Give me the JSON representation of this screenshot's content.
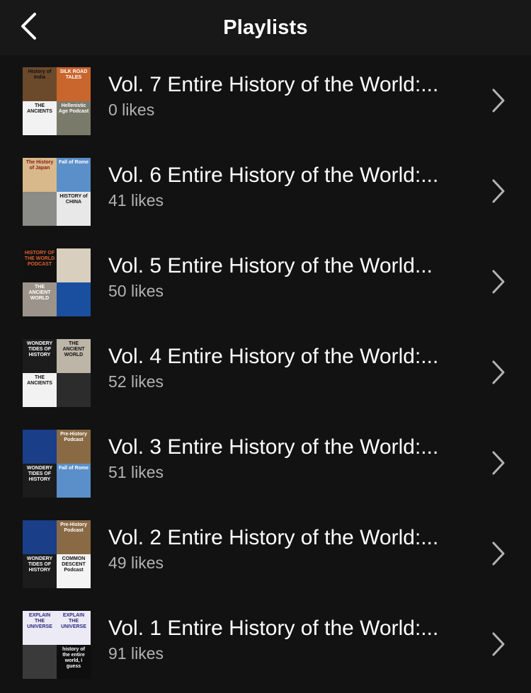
{
  "header": {
    "title": "Playlists"
  },
  "colors": {
    "background": "#121212",
    "header_bg": "#181818",
    "secondary_text": "#b3b3b3"
  },
  "playlists": [
    {
      "name": "Vol. 7 Entire History of the World:...",
      "likes": "0 likes",
      "tiles": [
        {
          "text": "History of India",
          "bg": "#6b4a2b",
          "fg": "#111"
        },
        {
          "text": "SILK ROAD TALES",
          "bg": "#c9662e",
          "fg": "#fff"
        },
        {
          "text": "THE ANCIENTS",
          "bg": "#f2f2f2",
          "fg": "#111"
        },
        {
          "text": "Hellenistic Age Podcast",
          "bg": "#7a7a6a",
          "fg": "#fff"
        }
      ]
    },
    {
      "name": "Vol. 6 Entire History of the World:...",
      "likes": "41 likes",
      "tiles": [
        {
          "text": "The History of Japan",
          "bg": "#d8b98a",
          "fg": "#8b1a1a"
        },
        {
          "text": "Fall of Rome",
          "bg": "#5a8fc9",
          "fg": "#fff"
        },
        {
          "text": "",
          "bg": "#8b8b88",
          "fg": "#111"
        },
        {
          "text": "HISTORY of CHINA",
          "bg": "#e8e8e8",
          "fg": "#111"
        }
      ]
    },
    {
      "name": "Vol. 5 Entire History of the World...",
      "likes": "50 likes",
      "tiles": [
        {
          "text": "HISTORY OF THE WORLD PODCAST",
          "bg": "#111111",
          "fg": "#e0602c"
        },
        {
          "text": "",
          "bg": "#d9cfbf",
          "fg": "#111"
        },
        {
          "text": "THE ANCIENT WORLD",
          "bg": "#9c948a",
          "fg": "#fff"
        },
        {
          "text": "",
          "bg": "#1a4fa0",
          "fg": "#fff"
        }
      ]
    },
    {
      "name": "Vol. 4 Entire History of the World:...",
      "likes": "52 likes",
      "tiles": [
        {
          "text": "WONDERY TIDES OF HISTORY",
          "bg": "#1c1c1c",
          "fg": "#fff"
        },
        {
          "text": "THE ANCIENT WORLD",
          "bg": "#bdb5a8",
          "fg": "#111"
        },
        {
          "text": "THE ANCIENTS",
          "bg": "#f2f2f2",
          "fg": "#111"
        },
        {
          "text": "",
          "bg": "#2c2c2c",
          "fg": "#fff"
        }
      ]
    },
    {
      "name": "Vol. 3 Entire History of the World:...",
      "likes": "51 likes",
      "tiles": [
        {
          "text": "",
          "bg": "#1a3f88",
          "fg": "#fff"
        },
        {
          "text": "Pre-History Podcast",
          "bg": "#8a6a45",
          "fg": "#fff"
        },
        {
          "text": "WONDERY TIDES OF HISTORY",
          "bg": "#1c1c1c",
          "fg": "#fff"
        },
        {
          "text": "Fall of Rome",
          "bg": "#5a8fc9",
          "fg": "#fff"
        }
      ]
    },
    {
      "name": "Vol. 2 Entire History of the World:...",
      "likes": "49 likes",
      "tiles": [
        {
          "text": "",
          "bg": "#1a3f88",
          "fg": "#fff"
        },
        {
          "text": "Pre-History Podcast",
          "bg": "#8a6a45",
          "fg": "#fff"
        },
        {
          "text": "WONDERY TIDES OF HISTORY",
          "bg": "#1c1c1c",
          "fg": "#fff"
        },
        {
          "text": "COMMON DESCENT Podcast",
          "bg": "#f4f4f4",
          "fg": "#111"
        }
      ]
    },
    {
      "name": "Vol. 1 Entire History of the World:...",
      "likes": "91 likes",
      "tiles": [
        {
          "text": "EXPLAIN THE UNIVERSE",
          "bg": "#eceaf4",
          "fg": "#2a2a80"
        },
        {
          "text": "EXPLAIN THE UNIVERSE",
          "bg": "#eceaf4",
          "fg": "#2a2a80"
        },
        {
          "text": "",
          "bg": "#3a3a3a",
          "fg": "#fff"
        },
        {
          "text": "history of the entire world, i guess",
          "bg": "#0e0e0e",
          "fg": "#fff"
        }
      ]
    }
  ]
}
